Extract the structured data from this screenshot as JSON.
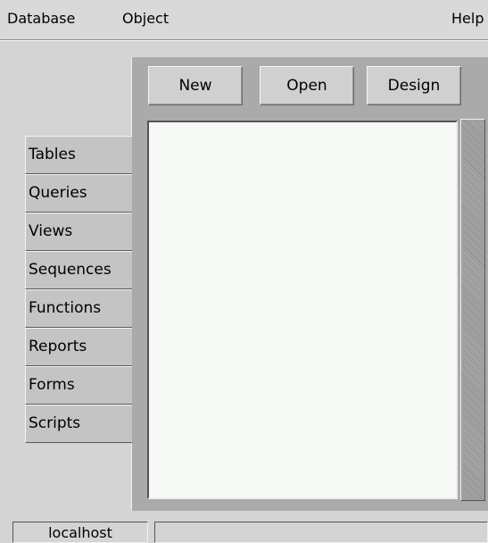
{
  "menubar": {
    "items": [
      "Database",
      "Object"
    ],
    "help": "Help"
  },
  "toolbar": {
    "new_label": "New",
    "open_label": "Open",
    "design_label": "Design"
  },
  "sidebar": {
    "tabs": [
      {
        "label": "Tables"
      },
      {
        "label": "Queries"
      },
      {
        "label": "Views"
      },
      {
        "label": "Sequences"
      },
      {
        "label": "Functions"
      },
      {
        "label": "Reports"
      },
      {
        "label": "Forms"
      },
      {
        "label": "Scripts"
      }
    ]
  },
  "statusbar": {
    "host": "localhost",
    "message": ""
  }
}
